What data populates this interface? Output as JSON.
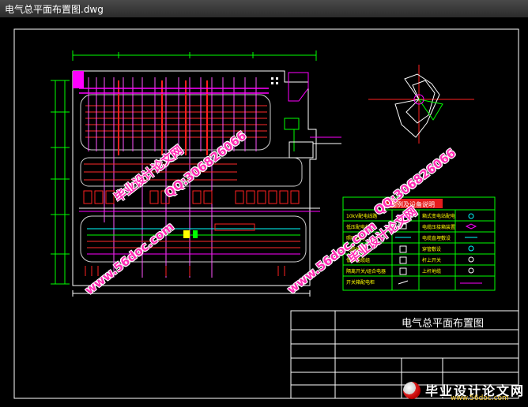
{
  "window": {
    "title": "电气总平面布置图.dwg"
  },
  "title_block": {
    "drawing_title": "电气总平面布置图"
  },
  "legend": {
    "header": "图例及设备说明",
    "rows": [
      {
        "left": "10kV配电线路",
        "right": "箱式变电站配电"
      },
      {
        "left": "低压配电线",
        "right": "电缆压接箱装置"
      },
      {
        "left": "照明线路",
        "right": "电缆直埋敷设"
      },
      {
        "left": "电缆桥",
        "right": "穿管敷设"
      },
      {
        "left": "低压电缆组",
        "right": "杆上开关"
      },
      {
        "left": "隔离开关/组合电器",
        "right": "上杆地缆"
      },
      {
        "left": "开关箱配电柜",
        "right": ""
      }
    ]
  },
  "watermarks": {
    "site": "www.56doc.com",
    "slogan": "毕业设计论文网",
    "qq": "QQ:306826066"
  },
  "logo": {
    "name": "毕业设计论文网",
    "url": "www.56doc.com"
  },
  "colors": {
    "magenta": "#ff00ff",
    "red": "#ff2020",
    "green": "#00ff00",
    "yellow": "#ffff00",
    "cyan": "#00ffff",
    "white": "#ffffff",
    "watermark": "#ff2db4"
  }
}
